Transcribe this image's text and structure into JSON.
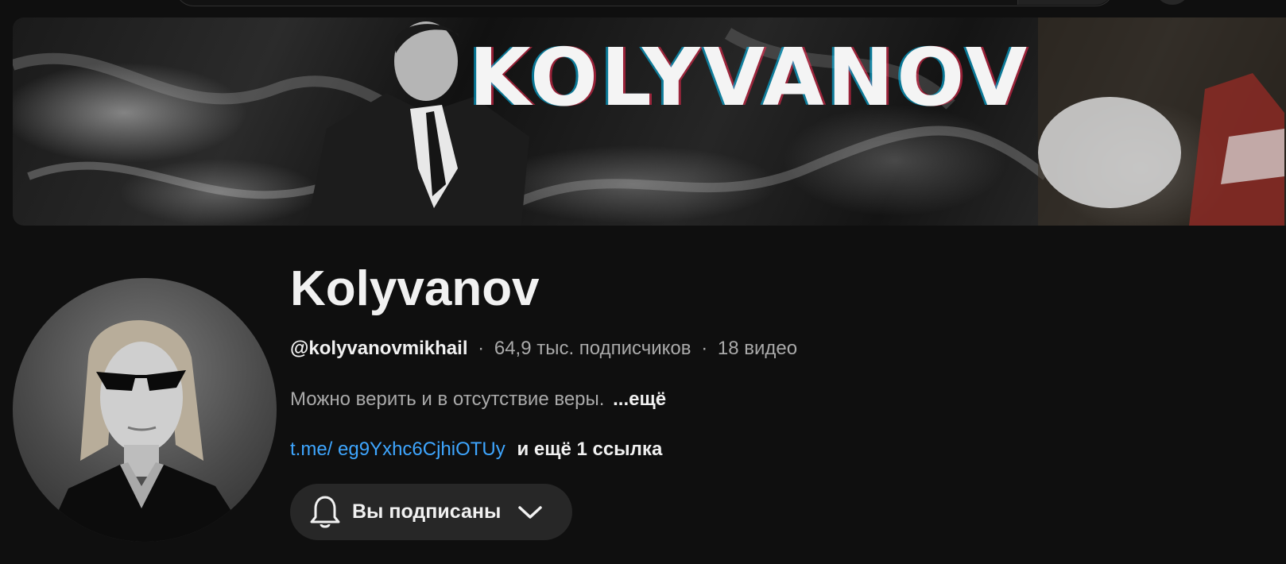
{
  "banner": {
    "word": "KOLYVANOV"
  },
  "channel": {
    "name": "Kolyvanov",
    "handle": "@kolyvanovmikhail",
    "subscribers": "64,9 тыс. подписчиков",
    "videos": "18 видео",
    "separator": "·",
    "description": "Можно верить и в отсутствие веры.",
    "more_label": "...ещё",
    "link_url": "t.me/ eg9Yxhc6CjhiOTUy",
    "link_more": "и ещё 1 ссылка"
  },
  "subscribe_button": {
    "label": "Вы подписаны",
    "icon": "bell-icon",
    "dropdown_icon": "chevron-down-icon"
  },
  "colors": {
    "background": "#0f0f0f",
    "link": "#3ea6ff",
    "secondary_text": "#aaaaaa",
    "button_bg": "#272727"
  }
}
